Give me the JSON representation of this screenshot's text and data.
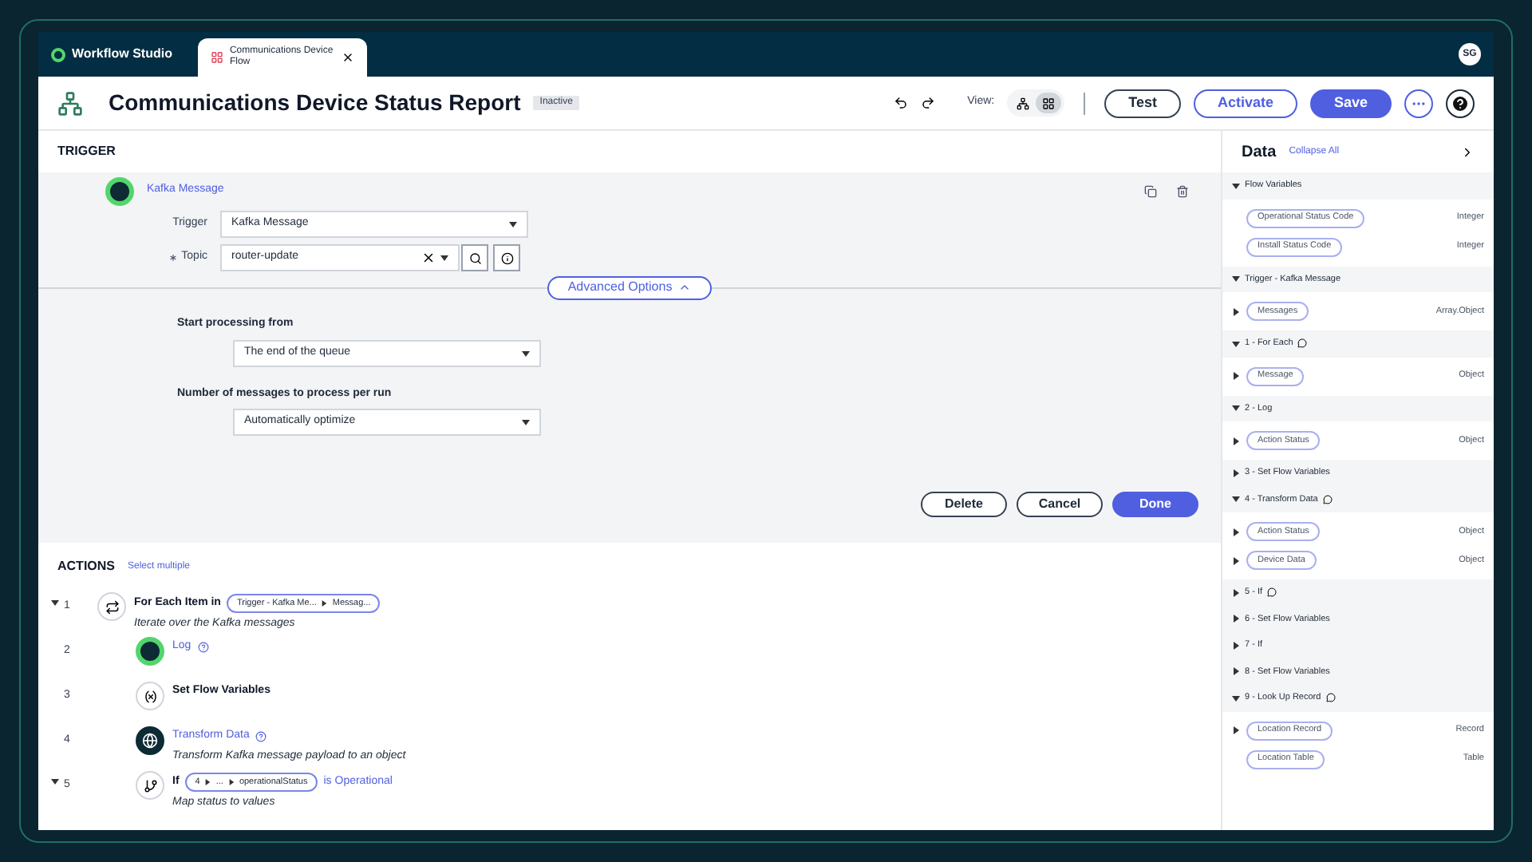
{
  "window": {
    "app_name": "Workflow Studio",
    "tab": {
      "title": "Communications Device",
      "subtitle": "Flow"
    },
    "avatar": "SG"
  },
  "toolbar": {
    "title": "Communications Device Status Report",
    "status": "Inactive",
    "view_label": "View:",
    "view_modes": [
      {
        "kind": "tree",
        "selected": false
      },
      {
        "kind": "grid",
        "selected": true
      }
    ],
    "buttons": [
      {
        "label": "Test",
        "kind": "outline"
      },
      {
        "label": "Activate",
        "kind": "accent"
      },
      {
        "label": "Save",
        "kind": "primary"
      }
    ]
  },
  "trigger": {
    "heading": "TRIGGER",
    "step_name": "Kafka Message",
    "fields": [
      {
        "label": "Trigger",
        "value": "Kafka Message",
        "required": false,
        "kind": "select"
      },
      {
        "label": "Topic",
        "value": "router-update",
        "required": true,
        "kind": "lookup"
      }
    ],
    "advanced": {
      "label": "Advanced Options",
      "expanded": true
    },
    "settings": [
      {
        "label": "Start processing from",
        "value": "The end of the queue"
      },
      {
        "label": "Number of messages to process per run",
        "value": "Automatically optimize"
      }
    ],
    "buttons": [
      {
        "label": "Delete",
        "kind": "outline"
      },
      {
        "label": "Cancel",
        "kind": "outline"
      },
      {
        "label": "Done",
        "kind": "primary"
      }
    ]
  },
  "actions": {
    "heading": "ACTIONS",
    "link": "Select multiple",
    "rows": [
      {
        "number": "1",
        "expanded": true,
        "kind": "loop",
        "title": "For Each Item in",
        "link": false,
        "help": false,
        "pills": [
          "Trigger - Kafka Me...",
          "Messag..."
        ],
        "description": "Iterate over the Kafka messages"
      },
      {
        "number": "2",
        "kind": "log",
        "title": "Log",
        "link": true,
        "help": true
      },
      {
        "number": "3",
        "kind": "set",
        "title": "Set Flow Variables",
        "link": false,
        "help": false
      },
      {
        "number": "4",
        "kind": "transform",
        "title": "Transform Data",
        "link": true,
        "help": true,
        "description": "Transform Kafka message payload to an object"
      },
      {
        "number": "5",
        "expanded": true,
        "kind": "if",
        "title": "If",
        "link": false,
        "help": false,
        "pills": [
          "4",
          "...",
          "operationalStatus"
        ],
        "suffix": "is Operational",
        "description": "Map status to values"
      }
    ]
  },
  "data_panel": {
    "title": "Data",
    "link": "Collapse All",
    "sections": [
      {
        "title": "Flow Variables",
        "expanded": true,
        "comment": false,
        "items": [
          {
            "name": "Operational Status Code",
            "type": "Integer",
            "expandable": false
          },
          {
            "name": "Install Status Code",
            "type": "Integer",
            "expandable": false
          }
        ]
      },
      {
        "title": "Trigger - Kafka Message",
        "expanded": true,
        "comment": false,
        "items": [
          {
            "name": "Messages",
            "type": "Array.Object",
            "expandable": true
          }
        ]
      },
      {
        "title": "1 - For Each",
        "expanded": true,
        "comment": true,
        "items": [
          {
            "name": "Message",
            "type": "Object",
            "expandable": true
          }
        ]
      },
      {
        "title": "2 - Log",
        "expanded": true,
        "comment": false,
        "items": [
          {
            "name": "Action Status",
            "type": "Object",
            "expandable": true
          }
        ]
      },
      {
        "title": "3 - Set Flow Variables",
        "expanded": false,
        "comment": false
      },
      {
        "title": "4 - Transform Data",
        "expanded": true,
        "comment": true,
        "items": [
          {
            "name": "Action Status",
            "type": "Object",
            "expandable": true
          },
          {
            "name": "Device Data",
            "type": "Object",
            "expandable": true
          }
        ]
      },
      {
        "title": "5 - If",
        "expanded": false,
        "comment": true
      },
      {
        "title": "6 - Set Flow Variables",
        "expanded": false,
        "comment": false
      },
      {
        "title": "7 - If",
        "expanded": false,
        "comment": false
      },
      {
        "title": "8 - Set Flow Variables",
        "expanded": false,
        "comment": false
      },
      {
        "title": "9 - Look Up Record",
        "expanded": true,
        "comment": true,
        "items": [
          {
            "name": "Location Record",
            "type": "Record",
            "expandable": true
          },
          {
            "name": "Location Table",
            "type": "Table",
            "expandable": false
          }
        ]
      }
    ]
  }
}
